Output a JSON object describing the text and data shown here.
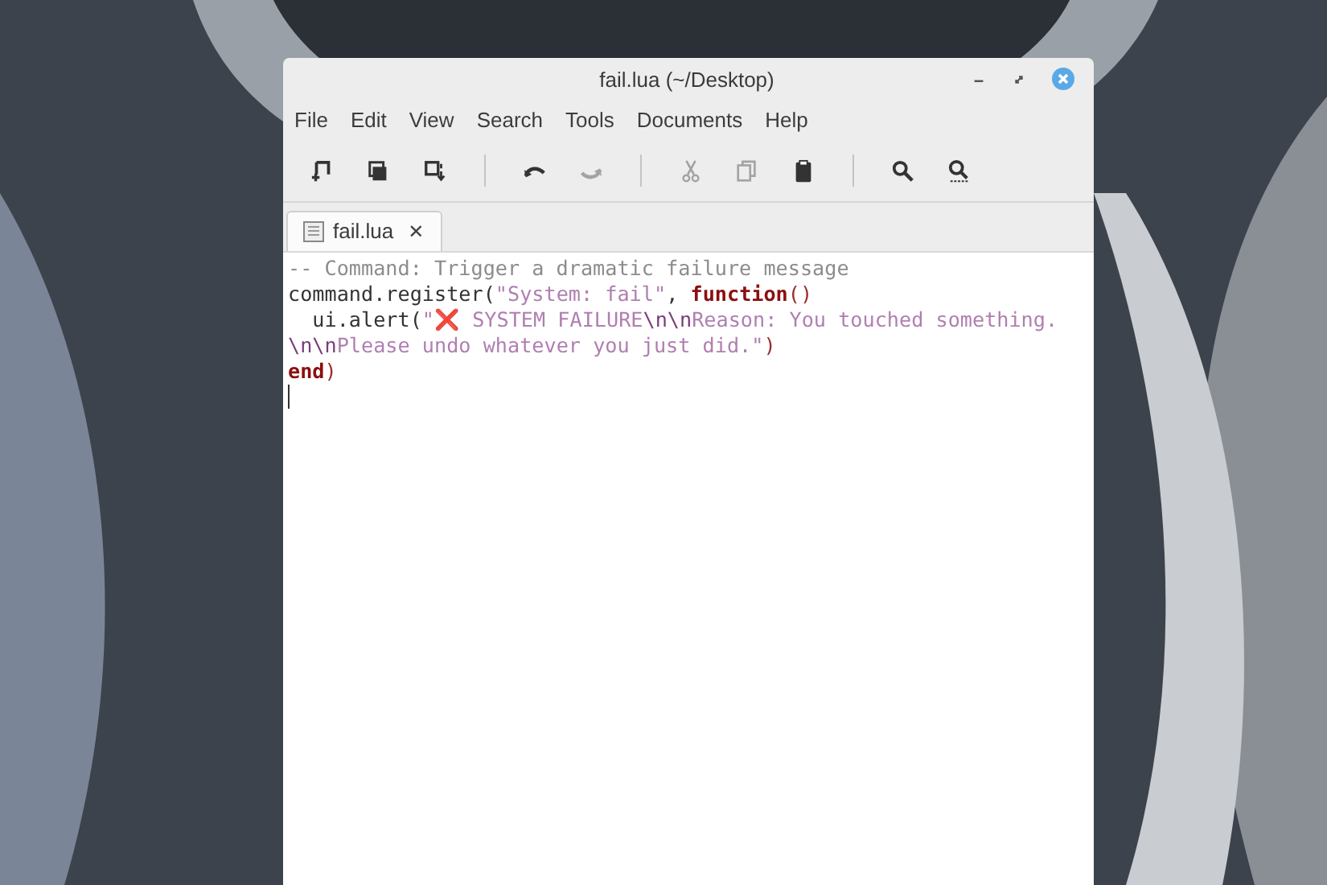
{
  "window": {
    "title": "fail.lua (~/Desktop)"
  },
  "menu": [
    "File",
    "Edit",
    "View",
    "Search",
    "Tools",
    "Documents",
    "Help"
  ],
  "toolbar_groups": [
    [
      {
        "disabled": false
      },
      {
        "disabled": false
      },
      {
        "disabled": false
      }
    ],
    [
      {
        "disabled": false
      },
      {
        "disabled": true
      }
    ],
    [
      {
        "disabled": true
      },
      {
        "disabled": true
      },
      {
        "disabled": false
      }
    ],
    [
      {
        "disabled": false
      },
      {
        "disabled": false
      }
    ]
  ],
  "tabs": [
    {
      "label": "fail.lua",
      "selected": true,
      "close": "✕"
    }
  ],
  "code_lines": [
    [
      {
        "kind": "comment",
        "text": "-- Command: Trigger a dramatic failure message"
      }
    ],
    [
      {
        "kind": "plain",
        "text": "command.register("
      },
      {
        "kind": "string",
        "text": "\"System: fail\""
      },
      {
        "kind": "plain",
        "text": ", "
      },
      {
        "kind": "keyword",
        "text": "function"
      },
      {
        "kind": "paren",
        "text": "()"
      }
    ],
    [
      {
        "kind": "plain",
        "text": "  ui.alert("
      },
      {
        "kind": "string",
        "text": "\""
      },
      {
        "kind": "emoji",
        "text": "❌"
      },
      {
        "kind": "string",
        "text": " SYSTEM FAILURE"
      },
      {
        "kind": "escape",
        "text": "\\n\\n"
      },
      {
        "kind": "string",
        "text": "Reason: You touched something. "
      },
      {
        "kind": "escape",
        "text": "\\n\\n"
      },
      {
        "kind": "string",
        "text": "Please undo whatever you just did.\""
      },
      {
        "kind": "paren",
        "text": ")"
      }
    ],
    [
      {
        "kind": "keyword",
        "text": "end"
      },
      {
        "kind": "paren",
        "text": ")"
      }
    ]
  ]
}
